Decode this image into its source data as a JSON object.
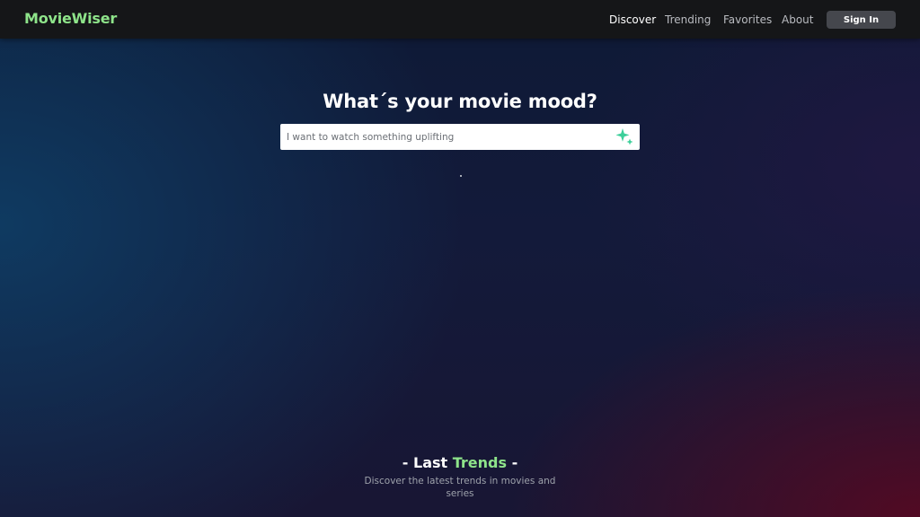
{
  "brand": {
    "name": "MovieWiser",
    "color": "#8ee48a"
  },
  "nav": {
    "items": [
      {
        "label": "Discover",
        "active": true
      },
      {
        "label": "Trending",
        "active": false
      },
      {
        "label": "Favorites",
        "active": false
      },
      {
        "label": "About",
        "active": false
      }
    ],
    "signin_label": "Sign In"
  },
  "hero": {
    "title": "What´s your movie mood?",
    "search": {
      "value": "",
      "placeholder": "I want to watch something uplifting",
      "submit_icon": "sparkles-icon",
      "icon_color": "#3ccf9a"
    }
  },
  "trends": {
    "prefix": "- Last ",
    "highlight": "Trends",
    "suffix": " -",
    "subtitle": "Discover the latest trends in movies and series"
  }
}
